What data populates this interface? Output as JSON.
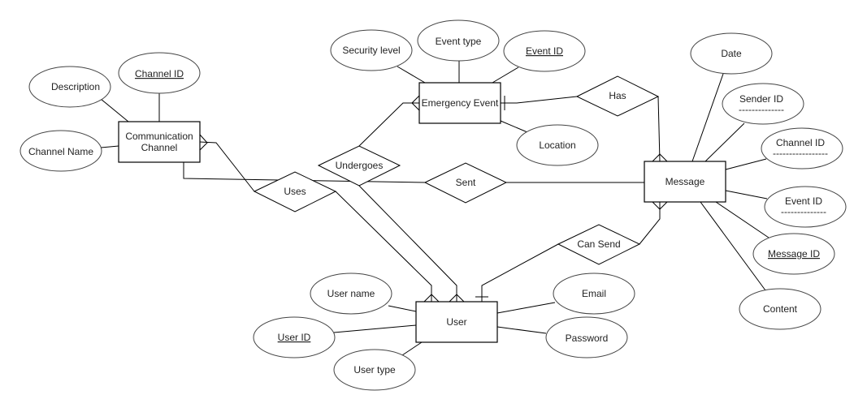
{
  "entities": {
    "communication_channel": [
      "Communication",
      "Channel"
    ],
    "emergency_event": "Emergency Event",
    "message": "Message",
    "user": "User"
  },
  "relationships": {
    "uses": "Uses",
    "undergoes": "Undergoes",
    "sent": "Sent",
    "has": "Has",
    "can_send": "Can Send"
  },
  "attributes": {
    "cc_description": "Description",
    "cc_channel_id": "Channel ID",
    "cc_channel_name": "Channel Name",
    "ee_security_level": "Security level",
    "ee_event_type": "Event type",
    "ee_event_id": "Event ID",
    "ee_location": "Location",
    "msg_date": "Date",
    "msg_sender_id": "Sender ID",
    "msg_channel_id": "Channel ID",
    "msg_event_id": "Event ID",
    "msg_message_id": "Message ID",
    "msg_content": "Content",
    "user_name": "User name",
    "user_id": "User ID",
    "user_type": "User type",
    "user_email": "Email",
    "user_password": "Password"
  },
  "foreign_key_marks": {
    "sender_id": "--------------",
    "channel_id": "-----------------",
    "event_id": "--------------"
  },
  "primary_keys": [
    "Channel ID",
    "Event ID",
    "Message ID",
    "User ID"
  ]
}
